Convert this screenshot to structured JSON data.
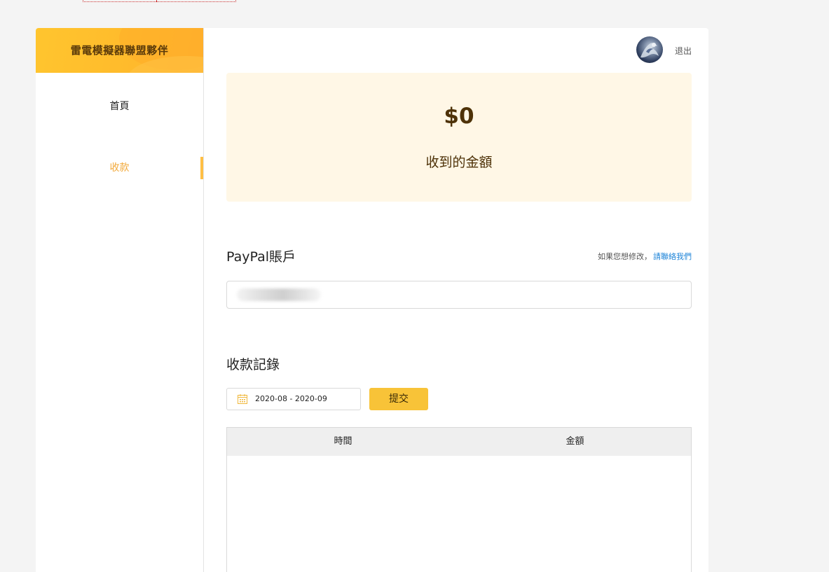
{
  "sidebar": {
    "brand_title": "雷電模擬器聯盟夥伴",
    "items": [
      {
        "label": "首頁",
        "active": false
      },
      {
        "label": "收款",
        "active": true
      }
    ]
  },
  "header": {
    "logout_label": "退出"
  },
  "stats": {
    "amount": "$0",
    "label": "收到的金額"
  },
  "paypal": {
    "title": "PayPal賬戶",
    "hint_prefix": "如果您想修改，",
    "hint_link": "請聯絡我們"
  },
  "records": {
    "title": "收款記錄",
    "date_range": "2020-08 - 2020-09",
    "submit_label": "提交",
    "columns": [
      "時間",
      "金額"
    ]
  },
  "colors": {
    "accent": "#ffbf44",
    "active_text": "#f2a93a",
    "link": "#1e84d8",
    "submit_bg": "#f8c338",
    "card_bg": "#fff7e6"
  }
}
